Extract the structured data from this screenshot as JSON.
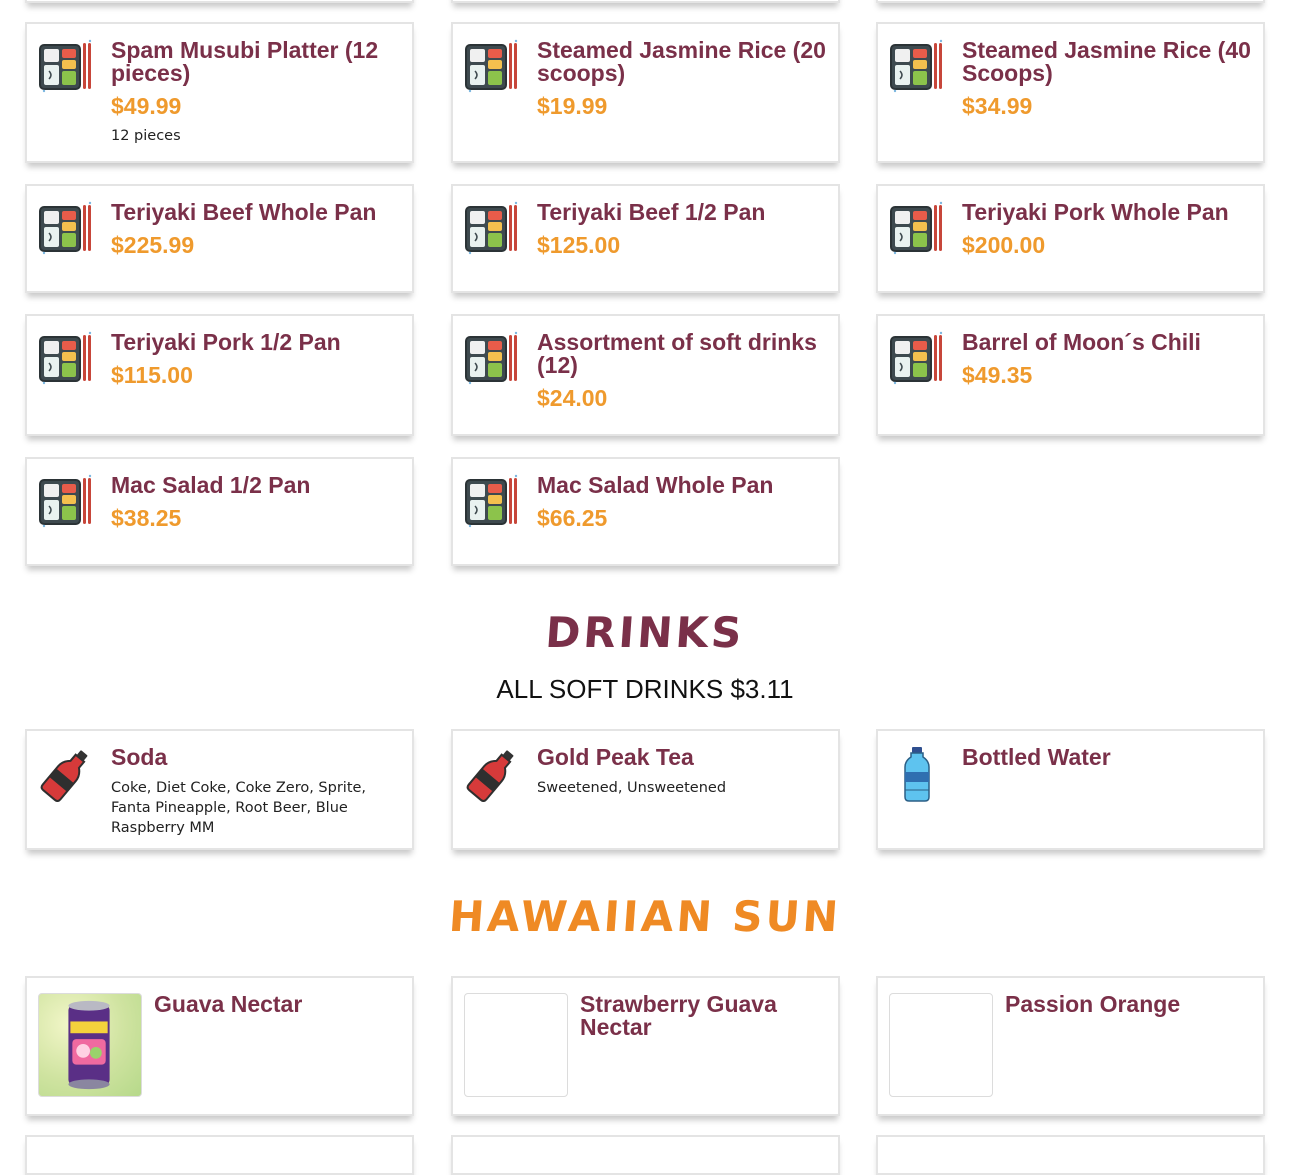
{
  "catering": [
    {
      "title": "Spam Musubi Platter (12 pieces)",
      "price": "$49.99",
      "desc": "12 pieces",
      "icon": "bento-box-icon"
    },
    {
      "title": "Steamed Jasmine Rice (20 scoops)",
      "price": "$19.99",
      "icon": "bento-box-icon"
    },
    {
      "title": "Steamed Jasmine Rice (40 Scoops)",
      "price": "$34.99",
      "icon": "bento-box-icon"
    },
    {
      "title": "Teriyaki Beef Whole Pan",
      "price": "$225.99",
      "icon": "bento-box-icon"
    },
    {
      "title": "Teriyaki Beef 1/2 Pan",
      "price": "$125.00",
      "icon": "bento-box-icon"
    },
    {
      "title": "Teriyaki Pork Whole Pan",
      "price": "$200.00",
      "icon": "bento-box-icon"
    },
    {
      "title": "Teriyaki Pork 1/2 Pan",
      "price": "$115.00",
      "icon": "bento-box-icon"
    },
    {
      "title": "Assortment of soft drinks (12)",
      "price": "$24.00",
      "icon": "bento-box-icon"
    },
    {
      "title": "Barrel of Moon´s Chili",
      "price": "$49.35",
      "icon": "bento-box-icon"
    },
    {
      "title": "Mac Salad 1/2 Pan",
      "price": "$38.25",
      "icon": "bento-box-icon"
    },
    {
      "title": "Mac Salad Whole Pan",
      "price": "$66.25",
      "icon": "bento-box-icon"
    }
  ],
  "drinks_section": {
    "title": "DRINKS",
    "subtitle": "ALL SOFT DRINKS $3.11",
    "items": [
      {
        "title": "Soda",
        "desc": "Coke, Diet Coke, Coke Zero, Sprite, Fanta Pineapple, Root Beer, Blue Raspberry MM",
        "icon": "soda-bottle-icon"
      },
      {
        "title": "Gold Peak Tea",
        "desc": "Sweetened, Unsweetened",
        "icon": "soda-bottle-icon"
      },
      {
        "title": "Bottled Water",
        "desc": "",
        "icon": "water-bottle-icon"
      }
    ]
  },
  "hawaiian_sun": {
    "title": "HAWAIIAN SUN",
    "items": [
      {
        "title": "Guava Nectar",
        "image": "guava-nectar-can-photo"
      },
      {
        "title": "Strawberry Guava Nectar",
        "image": ""
      },
      {
        "title": "Passion Orange",
        "image": ""
      }
    ]
  },
  "colors": {
    "title": "#7a3049",
    "price": "#ef9a2d",
    "drinks_heading": "#7a3049",
    "sun_heading": "#ef8a24"
  }
}
